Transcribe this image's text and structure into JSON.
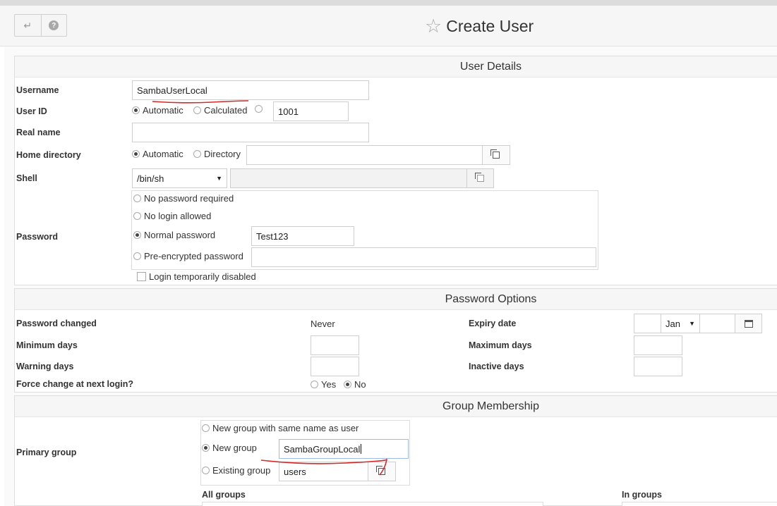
{
  "header": {
    "title": "Create User",
    "back_icon": "return-arrow-icon",
    "help_icon": "help-icon"
  },
  "user_details": {
    "section_title": "User Details",
    "username_label": "Username",
    "username_value": "SambaUserLocal",
    "userid_label": "User ID",
    "userid_automatic": "Automatic",
    "userid_calculated": "Calculated",
    "userid_value": "1001",
    "realname_label": "Real name",
    "realname_value": "",
    "homedir_label": "Home directory",
    "homedir_automatic": "Automatic",
    "homedir_directory": "Directory",
    "homedir_value": "",
    "shell_label": "Shell",
    "shell_value": "/bin/sh",
    "shell_custom_value": "",
    "password_label": "Password",
    "pw_none": "No password required",
    "pw_nologin": "No login allowed",
    "pw_normal": "Normal password",
    "pw_normal_value": "Test123",
    "pw_preenc": "Pre-encrypted password",
    "pw_preenc_value": "",
    "login_disabled": "Login temporarily disabled"
  },
  "password_options": {
    "section_title": "Password Options",
    "changed_label": "Password changed",
    "changed_value": "Never",
    "min_days_label": "Minimum days",
    "min_days_value": "",
    "warning_days_label": "Warning days",
    "warning_days_value": "",
    "force_change_label": "Force change at next login?",
    "force_yes": "Yes",
    "force_no": "No",
    "expiry_label": "Expiry date",
    "expiry_day": "",
    "expiry_month": "Jan",
    "expiry_year": "",
    "max_days_label": "Maximum days",
    "max_days_value": "",
    "inactive_days_label": "Inactive days",
    "inactive_days_value": ""
  },
  "group_membership": {
    "section_title": "Group Membership",
    "primary_group_label": "Primary group",
    "opt_same_name": "New group with same name as user",
    "opt_new_group": "New group",
    "new_group_value": "SambaGroupLocal",
    "opt_existing": "Existing group",
    "existing_value": "users",
    "all_groups_label": "All groups",
    "in_groups_label": "In groups"
  },
  "colors": {
    "annotation_red": "#d42a2a",
    "section_header_bg": "#f6f6f6"
  }
}
